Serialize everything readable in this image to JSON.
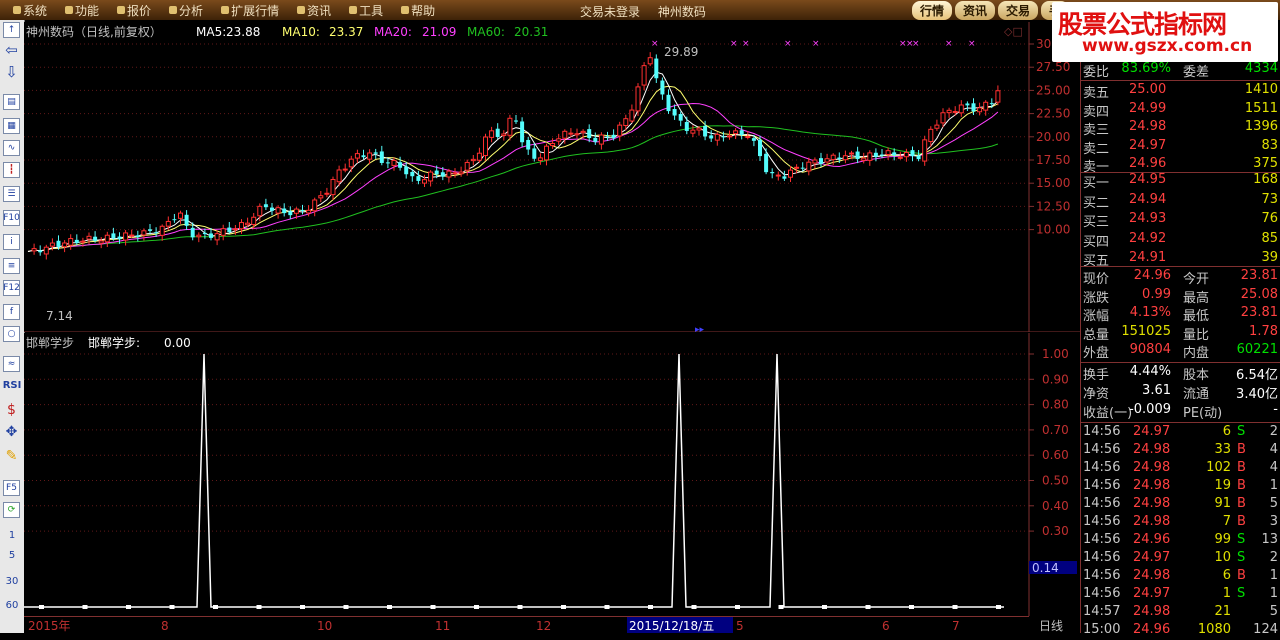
{
  "menu": [
    "系统",
    "功能",
    "报价",
    "分析",
    "扩展行情",
    "资讯",
    "工具",
    "帮助"
  ],
  "window_title": [
    "交易未登录",
    "神州数码"
  ],
  "right_tabs": [
    "行情",
    "资讯",
    "交易",
    "手"
  ],
  "watermark": {
    "line1": "股票公式指标网",
    "line2": "www.gszx.com.cn"
  },
  "left_toolbar_text": [
    "RSI",
    "1",
    "5",
    "30",
    "60"
  ],
  "main_chart": {
    "header": {
      "name": "神州数码（日线,前复权）",
      "ma5_label": "MA5:",
      "ma5": "23.88",
      "ma10_label": "MA10:",
      "ma10": "23.37",
      "ma20_label": "MA20:",
      "ma20": "21.09",
      "ma60_label": "MA60:",
      "ma60": "20.31"
    },
    "peak_label": "29.89",
    "low_label": "7.14",
    "y_ticks": [
      "30",
      "27.50",
      "25.00",
      "22.50",
      "20.00",
      "17.50",
      "15.00",
      "12.50",
      "10.00"
    ],
    "colors": {
      "up": "#ff3030",
      "down": "#54fcfc",
      "ma5": "#ffffff",
      "ma10": "#ffff70",
      "ma20": "#ff40ff",
      "ma60": "#20c020"
    }
  },
  "sub_chart": {
    "header": {
      "name": "邯郸学步",
      "label": "邯郸学步:",
      "value": "0.00"
    },
    "y_ticks": [
      "1.00",
      "0.90",
      "0.80",
      "0.70",
      "0.60",
      "0.50",
      "0.40",
      "0.30"
    ],
    "current_value": "0.14",
    "spikes": [
      1,
      1,
      1
    ]
  },
  "x_axis": {
    "labels": [
      "2015年",
      "8",
      "10",
      "11",
      "12",
      "2015/12/18/五",
      "5",
      "6",
      "7"
    ],
    "period": "日线"
  },
  "quotes": {
    "webi_label": "委比",
    "webi": "83.69%",
    "weicha_label": "委差",
    "weicha": "4334",
    "asks": [
      {
        "label": "卖五",
        "price": "25.00",
        "vol": "1410"
      },
      {
        "label": "卖四",
        "price": "24.99",
        "vol": "1511"
      },
      {
        "label": "卖三",
        "price": "24.98",
        "vol": "1396"
      },
      {
        "label": "卖二",
        "price": "24.97",
        "vol": "83"
      },
      {
        "label": "卖一",
        "price": "24.96",
        "vol": "375"
      }
    ],
    "bids": [
      {
        "label": "买一",
        "price": "24.95",
        "vol": "168"
      },
      {
        "label": "买二",
        "price": "24.94",
        "vol": "73"
      },
      {
        "label": "买三",
        "price": "24.93",
        "vol": "76"
      },
      {
        "label": "买四",
        "price": "24.92",
        "vol": "85"
      },
      {
        "label": "买五",
        "price": "24.91",
        "vol": "39"
      }
    ],
    "stats": [
      {
        "l1": "现价",
        "v1": "24.96",
        "c1": "red",
        "l2": "今开",
        "v2": "23.81",
        "c2": "red"
      },
      {
        "l1": "涨跌",
        "v1": "0.99",
        "c1": "red",
        "l2": "最高",
        "v2": "25.08",
        "c2": "red"
      },
      {
        "l1": "涨幅",
        "v1": "4.13%",
        "c1": "red",
        "l2": "最低",
        "v2": "23.81",
        "c2": "red"
      },
      {
        "l1": "总量",
        "v1": "151025",
        "c1": "yellow",
        "l2": "量比",
        "v2": "1.78",
        "c2": "red"
      },
      {
        "l1": "外盘",
        "v1": "90804",
        "c1": "red",
        "l2": "内盘",
        "v2": "60221",
        "c2": "green"
      }
    ],
    "stats2": [
      {
        "l1": "换手",
        "v1": "4.44%",
        "c1": "white",
        "l2": "股本",
        "v2": "6.54亿",
        "c2": "white"
      },
      {
        "l1": "净资",
        "v1": "3.61",
        "c1": "white",
        "l2": "流通",
        "v2": "3.40亿",
        "c2": "white"
      },
      {
        "l1": "收益(一)",
        "v1": "-0.009",
        "c1": "white",
        "l2": "PE(动)",
        "v2": "-",
        "c2": "white"
      }
    ]
  },
  "ticks": [
    {
      "time": "14:56",
      "price": "24.97",
      "vol": "6",
      "bs": "S",
      "n": "2"
    },
    {
      "time": "14:56",
      "price": "24.98",
      "vol": "33",
      "bs": "B",
      "n": "4"
    },
    {
      "time": "14:56",
      "price": "24.98",
      "vol": "102",
      "bs": "B",
      "n": "4"
    },
    {
      "time": "14:56",
      "price": "24.98",
      "vol": "19",
      "bs": "B",
      "n": "1"
    },
    {
      "time": "14:56",
      "price": "24.98",
      "vol": "91",
      "bs": "B",
      "n": "5"
    },
    {
      "time": "14:56",
      "price": "24.98",
      "vol": "7",
      "bs": "B",
      "n": "3"
    },
    {
      "time": "14:56",
      "price": "24.96",
      "vol": "99",
      "bs": "S",
      "n": "13"
    },
    {
      "time": "14:56",
      "price": "24.97",
      "vol": "10",
      "bs": "S",
      "n": "2"
    },
    {
      "time": "14:56",
      "price": "24.98",
      "vol": "6",
      "bs": "B",
      "n": "1"
    },
    {
      "time": "14:56",
      "price": "24.97",
      "vol": "1",
      "bs": "S",
      "n": "1"
    },
    {
      "time": "14:57",
      "price": "24.98",
      "vol": "21",
      "bs": "",
      "n": "5"
    },
    {
      "time": "15:00",
      "price": "24.96",
      "vol": "1080",
      "bs": "",
      "n": "124"
    }
  ]
}
